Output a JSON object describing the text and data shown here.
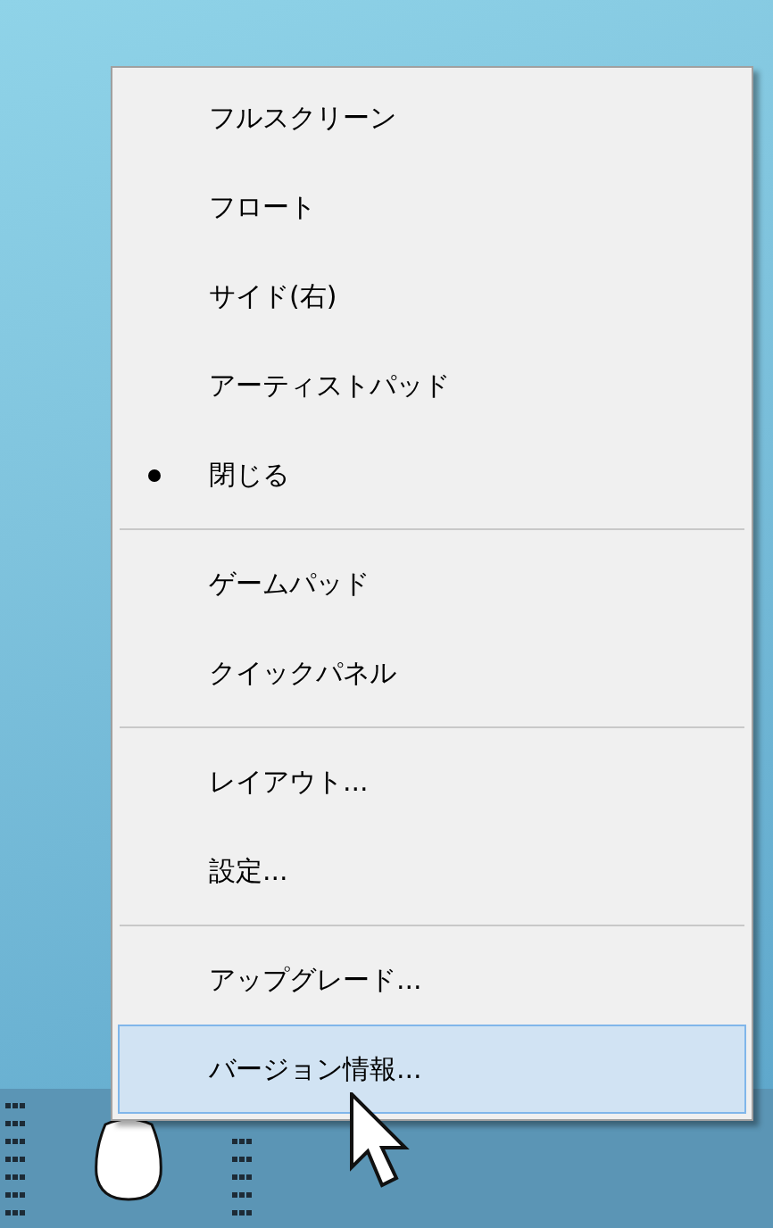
{
  "context_menu": {
    "items": [
      {
        "kind": "item",
        "label": "フルスクリーン",
        "checked": false,
        "selected": false
      },
      {
        "kind": "item",
        "label": "フロート",
        "checked": false,
        "selected": false
      },
      {
        "kind": "item",
        "label": "サイド(右)",
        "checked": false,
        "selected": false
      },
      {
        "kind": "item",
        "label": "アーティストパッド",
        "checked": false,
        "selected": false
      },
      {
        "kind": "item",
        "label": "閉じる",
        "checked": true,
        "selected": false
      },
      {
        "kind": "separator"
      },
      {
        "kind": "item",
        "label": "ゲームパッド",
        "checked": false,
        "selected": false
      },
      {
        "kind": "item",
        "label": "クイックパネル",
        "checked": false,
        "selected": false
      },
      {
        "kind": "separator"
      },
      {
        "kind": "item",
        "label": "レイアウト...",
        "checked": false,
        "selected": false
      },
      {
        "kind": "item",
        "label": "設定...",
        "checked": false,
        "selected": false
      },
      {
        "kind": "separator"
      },
      {
        "kind": "item",
        "label": "アップグレード...",
        "checked": false,
        "selected": false
      },
      {
        "kind": "item",
        "label": "バージョン情報...",
        "checked": false,
        "selected": true
      }
    ]
  }
}
